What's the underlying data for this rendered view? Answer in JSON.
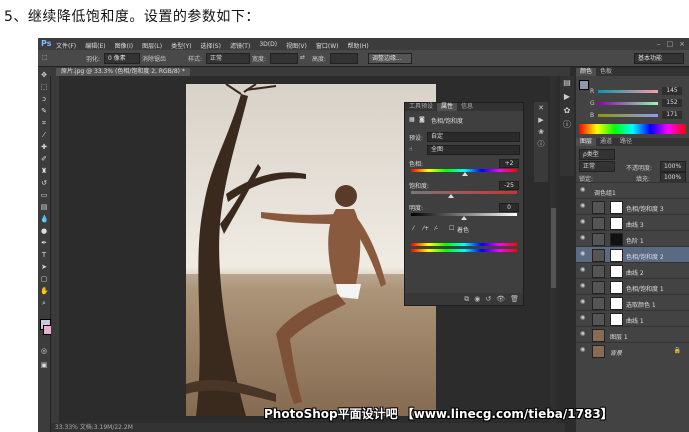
{
  "caption": "5、继续降低饱和度。设置的参数如下：",
  "ps": {
    "logo": "Ps",
    "menus": [
      "文件(F)",
      "编辑(E)",
      "图像(I)",
      "图层(L)",
      "类型(Y)",
      "选择(S)",
      "滤镜(T)",
      "3D(D)",
      "视图(V)",
      "窗口(W)",
      "帮助(H)"
    ],
    "options": {
      "feather_label": "羽化:",
      "feather_value": "0 像素",
      "antialias_label": "消除锯齿",
      "style_label": "样式:",
      "style_value": "正常",
      "width_label": "宽度:",
      "height_label": "高度:",
      "refine_button": "调整边缘...",
      "workspace": "基本功能"
    },
    "document_tab": "原片.jpg @ 33.3% (色相/饱和度 2, RGB/8) *",
    "status_text": "33.33%    文档:3.19M/22.2M",
    "properties": {
      "tabs": [
        "工具预设",
        "属性",
        "信息"
      ],
      "active_tab": "属性",
      "title": "色相/饱和度",
      "preset_label": "预设:",
      "preset_value": "自定",
      "channel_value": "全图",
      "hue_label": "色相:",
      "hue_value": "+2",
      "saturation_label": "饱和度:",
      "saturation_value": "-25",
      "lightness_label": "明度:",
      "lightness_value": "0",
      "colorize_label": "着色"
    },
    "color_panel": {
      "tabs": [
        "颜色",
        "色板"
      ],
      "channels": [
        {
          "name": "R",
          "value": "145"
        },
        {
          "name": "G",
          "value": "152"
        },
        {
          "name": "B",
          "value": "171"
        }
      ]
    },
    "layers_panel": {
      "tabs": [
        "图层",
        "通道",
        "路径"
      ],
      "kind_label": "ρ类型",
      "blend_mode": "正常",
      "opacity_label": "不透明度:",
      "opacity_value": "100%",
      "lock_label": "锁定:",
      "fill_label": "填充:",
      "fill_value": "100%",
      "layers": [
        {
          "name": "调色组1",
          "selected": false
        },
        {
          "name": "色相/饱和度 3",
          "selected": false
        },
        {
          "name": "曲线 3",
          "selected": false
        },
        {
          "name": "色阶 1",
          "selected": false
        },
        {
          "name": "色相/饱和度 2",
          "selected": true
        },
        {
          "name": "曲线 2",
          "selected": false
        },
        {
          "name": "色相/饱和度 1",
          "selected": false
        },
        {
          "name": "选取颜色 1",
          "selected": false
        },
        {
          "name": "曲线 1",
          "selected": false
        },
        {
          "name": "图层 1",
          "selected": false
        },
        {
          "name": "背景",
          "selected": false
        }
      ]
    }
  },
  "watermark": "PhotoShop平面设计吧 【www.linecg.com/tieba/1783】",
  "colors": {
    "ui_dark": "#2b2b2b",
    "panel": "#434343",
    "selection": "#5a6a82"
  }
}
